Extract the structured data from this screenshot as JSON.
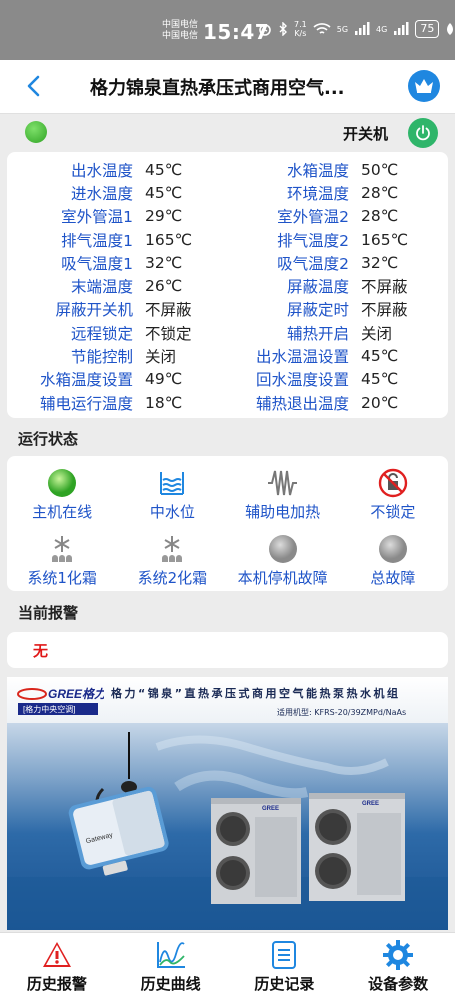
{
  "status_bar": {
    "carrier_1": "中国电信",
    "carrier_2": "中国电信",
    "time": "15:47",
    "net_speed_value": "7.1",
    "net_speed_unit": "K/s",
    "signal_5g": "5G",
    "signal_4g": "4G",
    "battery": "75"
  },
  "header": {
    "title": "格力锦泉直热承压式商用空气..."
  },
  "power": {
    "label": "开关机"
  },
  "params": {
    "rows": [
      {
        "l1": "出水温度",
        "v1": "45℃",
        "l2": "水箱温度",
        "v2": "50℃"
      },
      {
        "l1": "进水温度",
        "v1": "45℃",
        "l2": "环境温度",
        "v2": "28℃"
      },
      {
        "l1": "室外管温1",
        "v1": "29℃",
        "l2": "室外管温2",
        "v2": "28℃"
      },
      {
        "l1": "排气温度1",
        "v1": "165℃",
        "l2": "排气温度2",
        "v2": "165℃"
      },
      {
        "l1": "吸气温度1",
        "v1": "32℃",
        "l2": "吸气温度2",
        "v2": "32℃"
      },
      {
        "l1": "末端温度",
        "v1": "26℃",
        "l2": "屏蔽温度",
        "v2": "不屏蔽"
      },
      {
        "l1": "屏蔽开关机",
        "v1": "不屏蔽",
        "l2": "屏蔽定时",
        "v2": "不屏蔽"
      },
      {
        "l1": "远程锁定",
        "v1": "不锁定",
        "l2": "辅热开启",
        "v2": "关闭"
      },
      {
        "l1": "节能控制",
        "v1": "关闭",
        "l2": "出水温温设置",
        "v2": "45℃"
      },
      {
        "l1": "水箱温度设置",
        "v1": "49℃",
        "l2": "回水温度设置",
        "v2": "45℃"
      },
      {
        "l1": "辅电运行温度",
        "v1": "18℃",
        "l2": "辅热退出温度",
        "v2": "20℃"
      }
    ]
  },
  "running_status": {
    "title": "运行状态",
    "items": [
      {
        "label": "主机在线",
        "icon": "online-indicator-icon"
      },
      {
        "label": "中水位",
        "icon": "water-level-icon"
      },
      {
        "label": "辅助电加热",
        "icon": "electric-heater-icon"
      },
      {
        "label": "不锁定",
        "icon": "unlock-icon"
      },
      {
        "label": "系统1化霜",
        "icon": "defrost-icon"
      },
      {
        "label": "系统2化霜",
        "icon": "defrost-icon"
      },
      {
        "label": "本机停机故障",
        "icon": "fault-indicator-icon"
      },
      {
        "label": "总故障",
        "icon": "fault-indicator-icon"
      }
    ]
  },
  "alarm": {
    "title": "当前报警",
    "value": "无"
  },
  "banner": {
    "brand": "GREE格力",
    "brand_sub": "[格力中央空调]",
    "title": "格力“锦泉”直热承压式商用空气能热泵热水机组",
    "model": "适用机型: KFRS-20/39ZMPd/NaAs",
    "gateway_label": "Gateway",
    "unit_brand": "GREE"
  },
  "bottom_nav": [
    {
      "label": "历史报警",
      "icon": "warning-icon"
    },
    {
      "label": "历史曲线",
      "icon": "chart-curve-icon"
    },
    {
      "label": "历史记录",
      "icon": "record-list-icon"
    },
    {
      "label": "设备参数",
      "icon": "gear-icon"
    }
  ],
  "colors": {
    "accent_blue": "#1f54c8",
    "online_green": "#2fa324",
    "power_green": "#2fb56a",
    "alarm_red": "#e01818",
    "nav_blue": "#1f87e0"
  }
}
